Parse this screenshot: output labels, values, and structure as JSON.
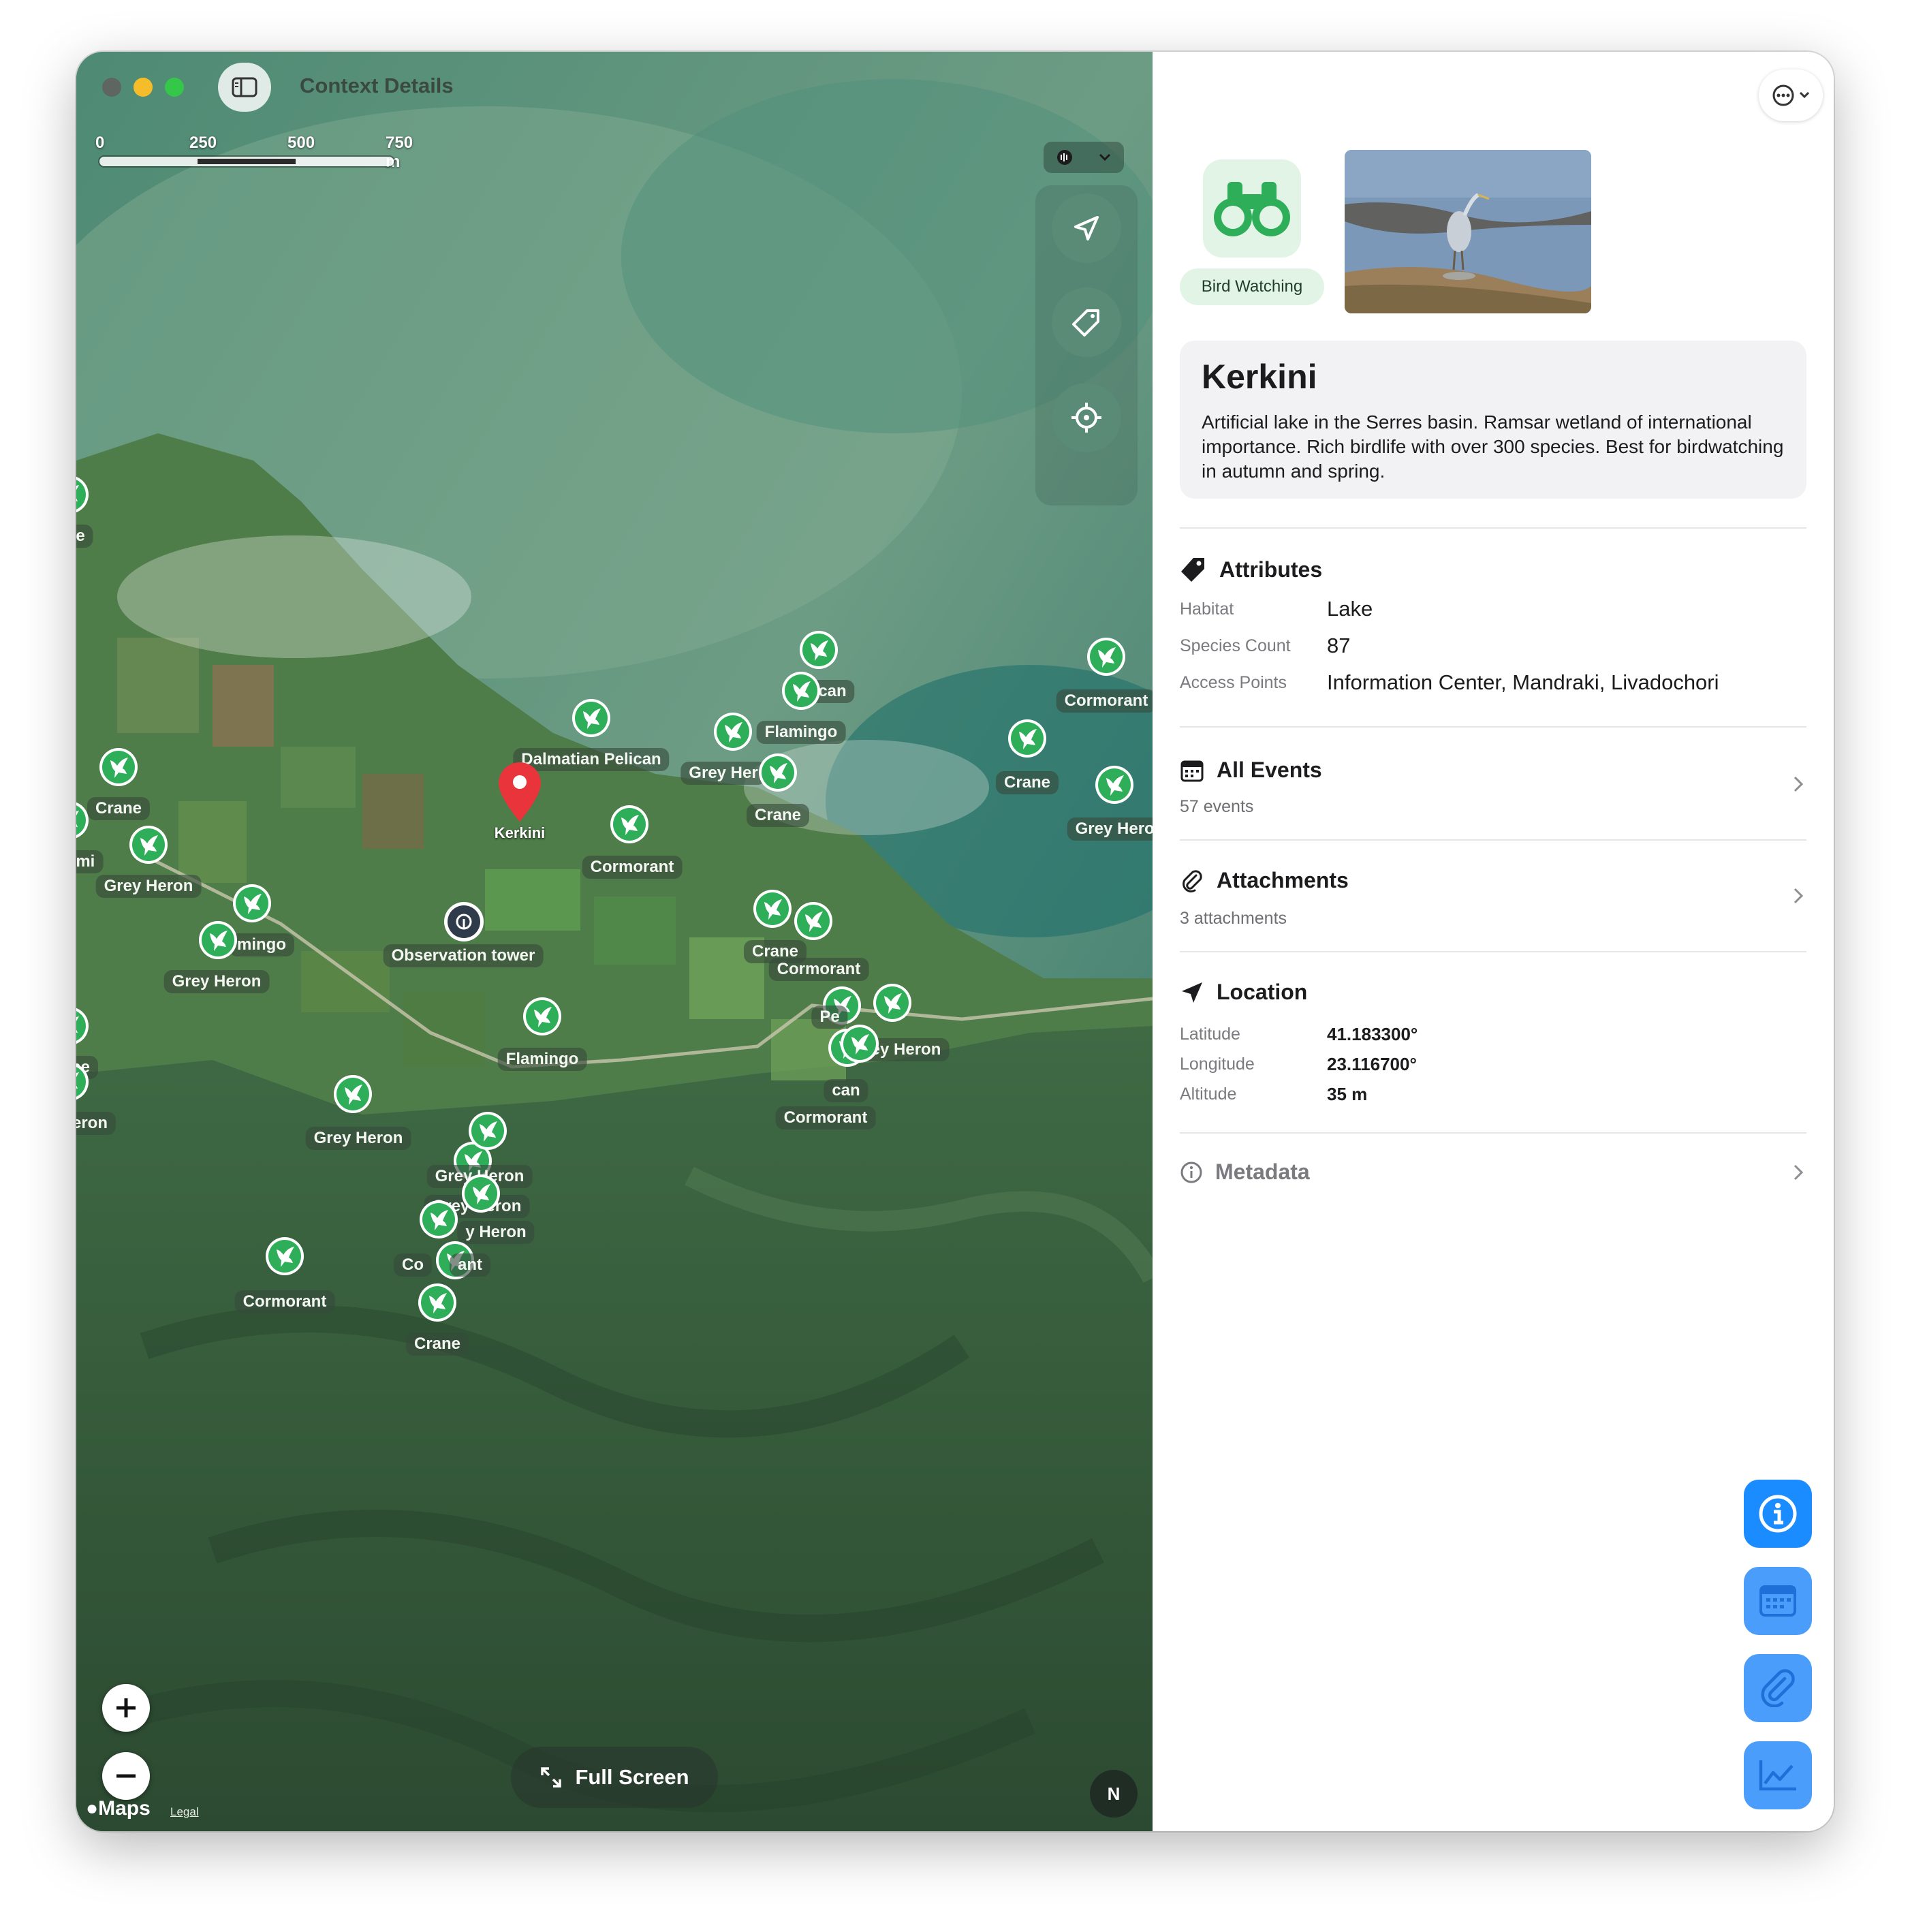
{
  "window": {
    "title": "Context Details"
  },
  "map": {
    "scale": {
      "labels": [
        "0",
        "250",
        "500",
        "750 m"
      ]
    },
    "selected_place": "Kerkini",
    "observation_tower": "Observation tower",
    "fullscreen_label": "Full Screen",
    "compass_label": "N",
    "brand": "Maps",
    "legal": "Legal",
    "pins": [
      {
        "label": "Crane"
      },
      {
        "label": "Flami"
      },
      {
        "label": "Grey Heron"
      },
      {
        "label": "mingo"
      },
      {
        "label": "Grey Heron"
      },
      {
        "label": "ne"
      },
      {
        "label": "eron"
      },
      {
        "label": "e"
      },
      {
        "label": "Dalmatian Pelican"
      },
      {
        "label": "Cormorant"
      },
      {
        "label": "Flamingo"
      },
      {
        "label": "Grey Heron"
      },
      {
        "label": "Grey Heron"
      },
      {
        "label": "Cormorant"
      },
      {
        "label": "Crane"
      },
      {
        "label": "can"
      },
      {
        "label": "Flamingo"
      },
      {
        "label": "Grey Her"
      },
      {
        "label": "Crane"
      },
      {
        "label": "Crane"
      },
      {
        "label": "Cormorant"
      },
      {
        "label": "Grey Heron"
      },
      {
        "label": "Crane"
      },
      {
        "label": "Cormorant"
      },
      {
        "label": "Pe"
      },
      {
        "label": "Grey Heron"
      },
      {
        "label": "can"
      },
      {
        "label": "Cormorant"
      },
      {
        "label": "Grey Heron"
      },
      {
        "label": "y Heron"
      },
      {
        "label": "Co"
      },
      {
        "label": "ant"
      }
    ]
  },
  "details": {
    "category": "Bird Watching",
    "title": "Kerkini",
    "description": "Artificial lake in the Serres basin. Ramsar wetland of international importance. Rich birdlife with over 300 species. Best for birdwatching in autumn and spring.",
    "attributes": {
      "heading": "Attributes",
      "rows": [
        {
          "key": "Habitat",
          "value": "Lake"
        },
        {
          "key": "Species Count",
          "value": "87"
        },
        {
          "key": "Access Points",
          "value": "Information Center, Mandraki, Livadochori"
        }
      ]
    },
    "events": {
      "heading": "All Events",
      "subtitle": "57 events"
    },
    "attachments": {
      "heading": "Attachments",
      "subtitle": "3 attachments"
    },
    "location": {
      "heading": "Location",
      "rows": [
        {
          "key": "Latitude",
          "value": "41.183300°"
        },
        {
          "key": "Longitude",
          "value": "23.116700°"
        },
        {
          "key": "Altitude",
          "value": "35 m"
        }
      ]
    },
    "metadata": {
      "heading": "Metadata"
    }
  },
  "colors": {
    "accent_green": "#2fae5a",
    "pin_red": "#e8343a",
    "fab_blue": "#1a8cff",
    "fab_blue_light": "#4a9dfa"
  },
  "icons": [
    "sidebar-toggle-icon",
    "location-arrow-icon",
    "tag-icon",
    "crosshair-icon",
    "bird-icon",
    "binoculars-icon",
    "ellipsis-icon",
    "calendar-icon",
    "paperclip-icon",
    "info-icon",
    "chart-icon",
    "expand-icon"
  ]
}
